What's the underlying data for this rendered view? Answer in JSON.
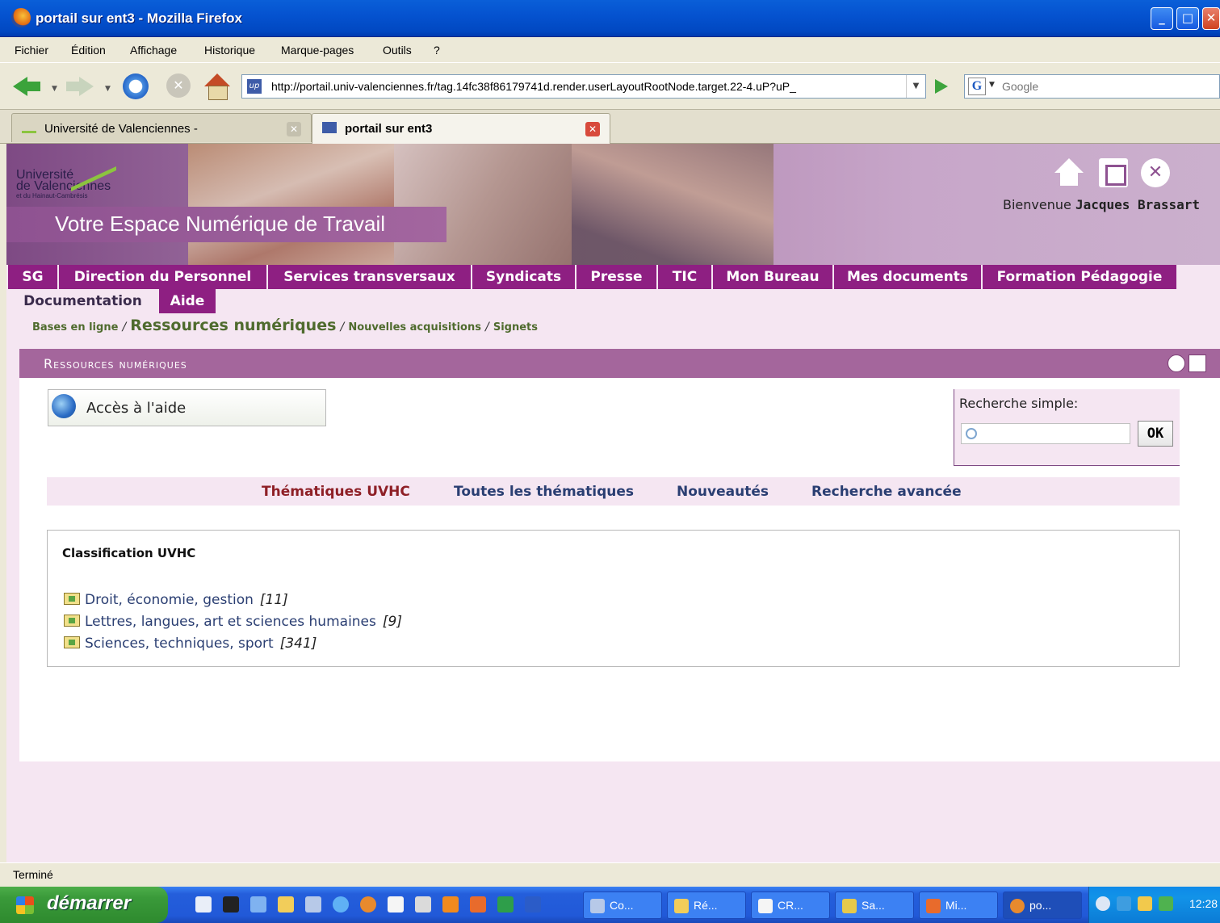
{
  "window": {
    "title": "portail sur ent3 - Mozilla Firefox",
    "minimize": "_",
    "maximize": "□",
    "close": "✕"
  },
  "menu": [
    "Fichier",
    "Édition",
    "Affichage",
    "Historique",
    "Marque-pages",
    "Outils",
    "?"
  ],
  "address": {
    "url": "http://portail.univ-valenciennes.fr/tag.14fc38f86179741d.render.userLayoutRootNode.target.22-4.uP?uP_",
    "favicon": "up"
  },
  "search_engine": {
    "letter": "G",
    "placeholder": "Google"
  },
  "tabs": [
    {
      "label": "Université de Valenciennes -",
      "icon": "page-icon"
    },
    {
      "label": "portail sur ent3",
      "icon": "up-favicon"
    }
  ],
  "banner": {
    "univ_name_line1": "Université",
    "univ_name_line2": "de Valenciennes",
    "univ_name_line3": "et du Hainaut-Cambrésis",
    "ent_title": "Votre Espace Numérique de Travail",
    "welcome_prefix": "Bienvenue",
    "welcome_user": "Jacques Brassart",
    "icons": [
      "home-icon",
      "sitemap-icon",
      "logout-icon"
    ]
  },
  "nav": {
    "row1": [
      "SG",
      "Direction du Personnel",
      "Services transversaux",
      "Syndicats",
      "Presse",
      "TIC",
      "Mon Bureau",
      "Mes documents",
      "Formation Pédagogie"
    ],
    "row2": [
      "Documentation",
      "Aide"
    ]
  },
  "breadcrumb": {
    "items": [
      "Bases en ligne",
      "Ressources numériques",
      "Nouvelles acquisitions",
      "Signets"
    ],
    "separator": "/"
  },
  "section": {
    "title": "Ressources numériques",
    "icons": [
      "zoom-icon",
      "print-icon"
    ]
  },
  "help": {
    "label": "Accès à l'aide"
  },
  "simple_search": {
    "label": "Recherche simple:",
    "button": "OK",
    "value": ""
  },
  "subtabs": [
    "Thématiques UVHC",
    "Toutes les thématiques",
    "Nouveautés",
    "Recherche avancée"
  ],
  "classification": {
    "title": "Classification UVHC",
    "items": [
      {
        "label": "Droit, économie, gestion",
        "count": "[11]"
      },
      {
        "label": "Lettres, langues, art et sciences humaines",
        "count": "[9]"
      },
      {
        "label": "Sciences, techniques, sport",
        "count": "[341]"
      }
    ]
  },
  "status": "Terminé",
  "taskbar": {
    "start": "démarrer",
    "tasks": [
      "Co...",
      "Ré...",
      "CR...",
      "Sa...",
      "Mi...",
      "po..."
    ],
    "clock": "12:28"
  },
  "colors": {
    "accent": "#8E1F82",
    "section": "#A4669C",
    "page_bg": "#F5E6F2",
    "link": "#2A3E72"
  }
}
